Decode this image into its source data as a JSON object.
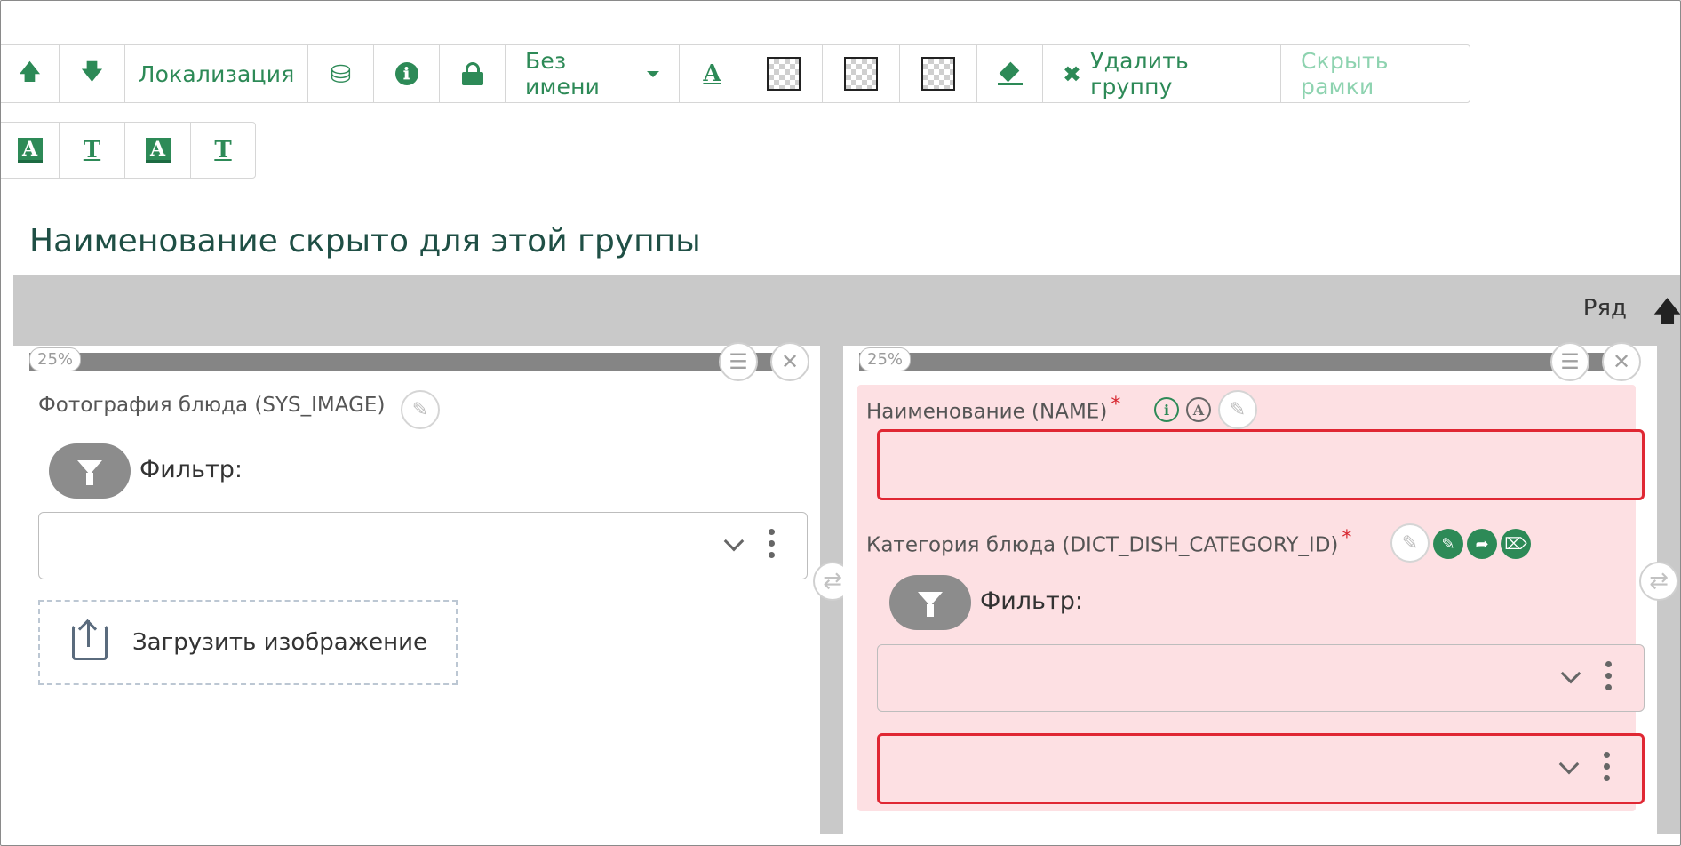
{
  "toolbar": {
    "localization_label": "Локализация",
    "name_dropdown_label": "Без имени",
    "delete_group_label": "Удалить группу",
    "hide_frames_label": "Скрыть рамки",
    "up_arrow": "🡅",
    "down_arrow": "🡇",
    "binoculars": "⛯",
    "info": "ℹ",
    "lock": "🔒",
    "letter": "A",
    "letter_t": "T",
    "eraser": "⌫",
    "cross": "✖"
  },
  "group": {
    "title": "Наименование скрыто для этой группы"
  },
  "row": {
    "label": "Ряд",
    "arrow": "🡅"
  },
  "columns": [
    {
      "percent": "25%",
      "photo_label": "Фотография блюда (SYS_IMAGE)",
      "filter_label": "Фильтр:",
      "upload_label": "Загрузить изображение"
    },
    {
      "percent": "25%",
      "name_label": "Наименование (NAME)",
      "category_label": "Категория блюда (DICT_DISH_CATEGORY_ID)",
      "filter_label": "Фильтр:",
      "required_mark": "*"
    }
  ],
  "icons": {
    "info_circle": "i",
    "a_circle": "A",
    "edit": "✎",
    "close": "✕",
    "list": "☰",
    "swap": "⇄",
    "pencil": "✎",
    "share": "➦",
    "eraser": "⌦"
  }
}
